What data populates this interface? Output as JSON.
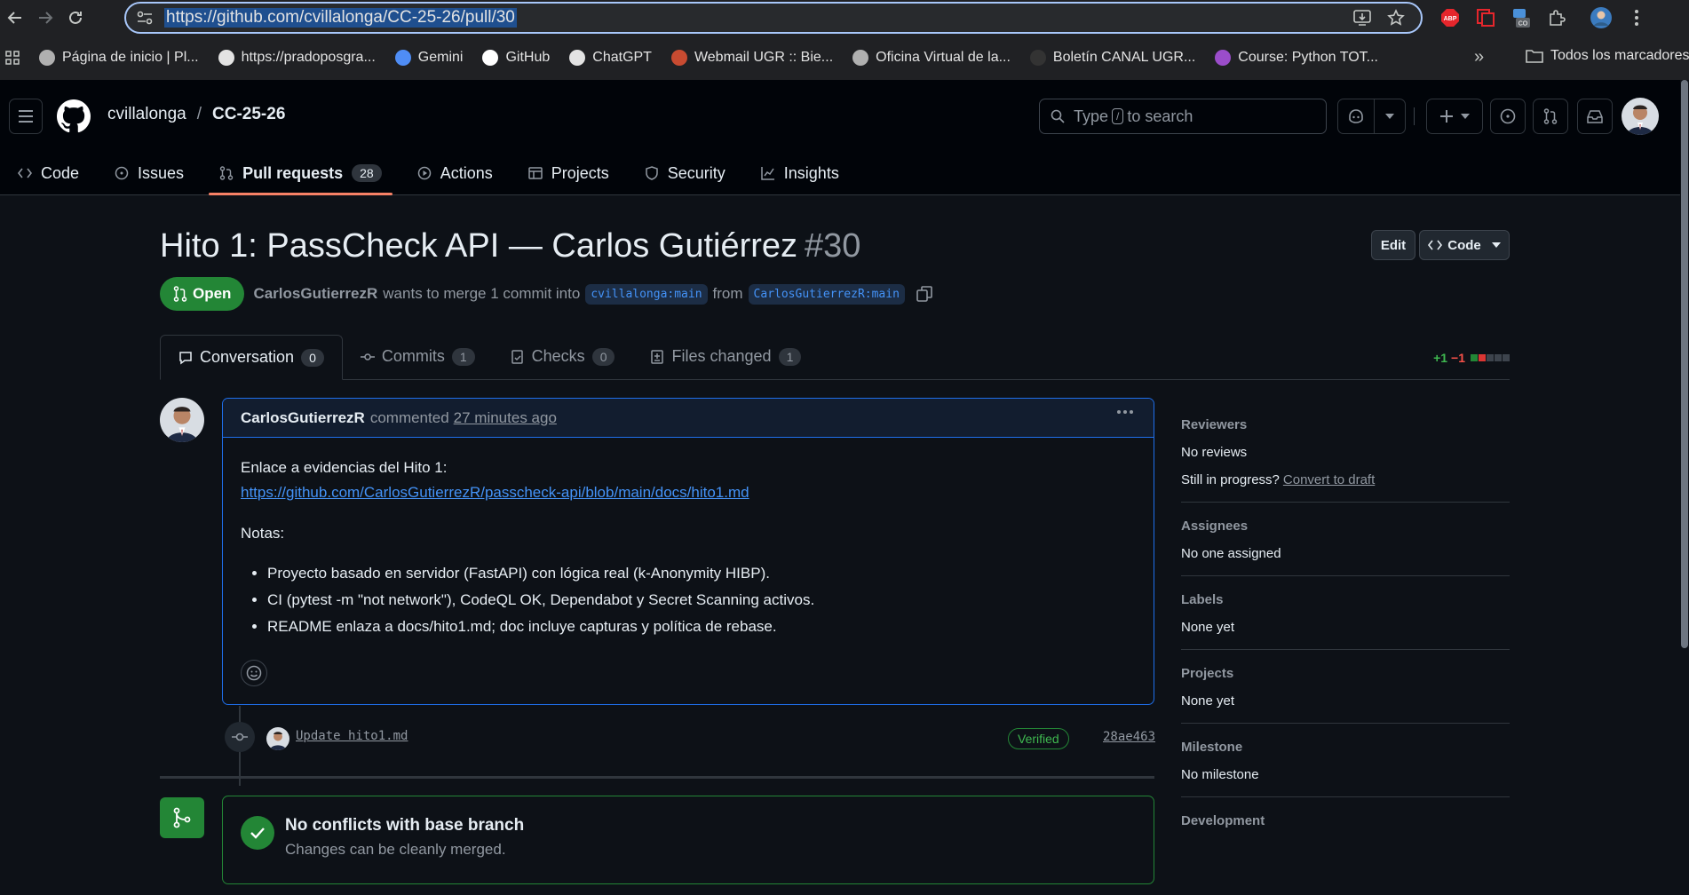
{
  "browser": {
    "url": "https://github.com/cvillalonga/CC-25-26/pull/30",
    "bookmarks": [
      {
        "label": "Página de inicio | Pl...",
        "color": "#b0b0b0"
      },
      {
        "label": "https://pradoposgra...",
        "color": "#e3e3e3"
      },
      {
        "label": "Gemini",
        "color": "#4f8df5"
      },
      {
        "label": "GitHub",
        "color": "#ffffff"
      },
      {
        "label": "ChatGPT",
        "color": "#e3e3e3"
      },
      {
        "label": "Webmail UGR :: Bie...",
        "color": "#c84b31"
      },
      {
        "label": "Oficina Virtual de la...",
        "color": "#b0b0b0"
      },
      {
        "label": "Boletín CANAL UGR...",
        "color": "#333333"
      },
      {
        "label": "Course: Python TOT...",
        "color": "#9b4dca"
      }
    ],
    "more_bookmarks": "»",
    "all_bookmarks": "Todos los marcadores",
    "extensions": {
      "abp": "ABP",
      "co": "CO"
    }
  },
  "header": {
    "owner": "cvillalonga",
    "separator": "/",
    "repo": "CC-25-26",
    "search_placeholder_pre": "Type",
    "search_key": "/",
    "search_placeholder_post": "to search"
  },
  "repo_nav": [
    {
      "label": "Code",
      "icon": "code-icon"
    },
    {
      "label": "Issues",
      "icon": "issue-icon"
    },
    {
      "label": "Pull requests",
      "icon": "pull-request-icon",
      "count": "28",
      "active": true
    },
    {
      "label": "Actions",
      "icon": "play-icon"
    },
    {
      "label": "Projects",
      "icon": "table-icon"
    },
    {
      "label": "Security",
      "icon": "shield-icon"
    },
    {
      "label": "Insights",
      "icon": "graph-icon"
    }
  ],
  "pr": {
    "title": "Hito 1: PassCheck API — Carlos Gutiérrez",
    "number": "#30",
    "edit_label": "Edit",
    "code_label": "Code",
    "state": "Open",
    "author": "CarlosGutierrezR",
    "merge_text": "wants to merge 1 commit into",
    "base_branch": "cvillalonga:main",
    "from_text": "from",
    "head_branch": "CarlosGutierrezR:main"
  },
  "pr_tabs": [
    {
      "label": "Conversation",
      "count": "0",
      "active": true
    },
    {
      "label": "Commits",
      "count": "1"
    },
    {
      "label": "Checks",
      "count": "0"
    },
    {
      "label": "Files changed",
      "count": "1"
    }
  ],
  "diffstat": {
    "additions": "+1",
    "deletions": "−1"
  },
  "comment": {
    "author": "CarlosGutierrezR",
    "action": "commented",
    "time": "27 minutes ago",
    "line1": "Enlace a evidencias del Hito 1:",
    "link": "https://github.com/CarlosGutierrezR/passcheck-api/blob/main/docs/hito1.md",
    "notes_label": "Notas:",
    "bullets": [
      "Proyecto basado en servidor (FastAPI) con lógica real (k-Anonymity HIBP).",
      "CI (pytest -m \"not network\"), CodeQL OK, Dependabot y Secret Scanning activos.",
      "README enlaza a docs/hito1.md; doc incluye capturas y política de rebase."
    ]
  },
  "commit": {
    "message": "Update hito1.md",
    "verified": "Verified",
    "sha": "28ae463"
  },
  "merge": {
    "title": "No conflicts with base branch",
    "subtitle": "Changes can be cleanly merged."
  },
  "sidebar": {
    "reviewers_h": "Reviewers",
    "reviewers_v": "No reviews",
    "draft_q": "Still in progress?",
    "draft_link": "Convert to draft",
    "assignees_h": "Assignees",
    "assignees_v": "No one assigned",
    "labels_h": "Labels",
    "labels_v": "None yet",
    "projects_h": "Projects",
    "projects_v": "None yet",
    "milestone_h": "Milestone",
    "milestone_v": "No milestone",
    "development_h": "Development"
  }
}
